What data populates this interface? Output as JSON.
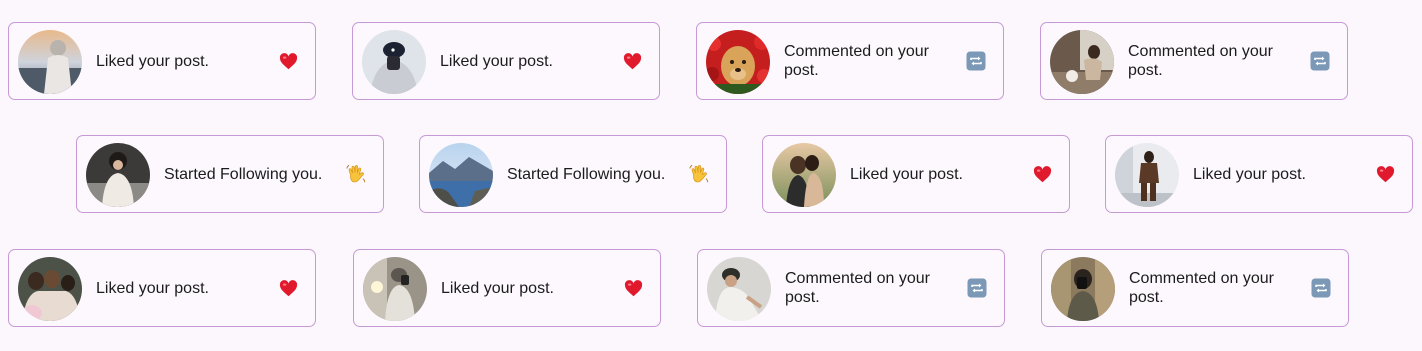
{
  "colors": {
    "background": "#fbf7fd",
    "card_border": "#c79ad6",
    "heart": "#e0192d",
    "repost": "#7b98b6"
  },
  "notifications": [
    {
      "message": "Liked your post.",
      "reaction_icon": "heart-icon",
      "avatar": "sunset-beach-photo"
    },
    {
      "message": "Liked your post.",
      "reaction_icon": "heart-icon",
      "avatar": "cap-selfie-photo"
    },
    {
      "message": "Commented on your post.",
      "reaction_icon": "repost-icon",
      "avatar": "golden-retriever-photo"
    },
    {
      "message": "Commented on your post.",
      "reaction_icon": "repost-icon",
      "avatar": "cafe-photo"
    },
    {
      "message": "Started Following you.",
      "reaction_icon": "waving-hand-icon",
      "avatar": "winter-coat-photo"
    },
    {
      "message": "Started Following you.",
      "reaction_icon": "waving-hand-icon",
      "avatar": "coastline-photo"
    },
    {
      "message": "Liked your post.",
      "reaction_icon": "heart-icon",
      "avatar": "friends-hug-photo"
    },
    {
      "message": "Liked your post.",
      "reaction_icon": "heart-icon",
      "avatar": "street-outfit-photo"
    },
    {
      "message": "Liked your post.",
      "reaction_icon": "heart-icon",
      "avatar": "group-selfie-photo"
    },
    {
      "message": "Liked your post.",
      "reaction_icon": "heart-icon",
      "avatar": "mirror-selfie-photo"
    },
    {
      "message": "Commented on your post.",
      "reaction_icon": "repost-icon",
      "avatar": "white-cap-photo"
    },
    {
      "message": "Commented on your post.",
      "reaction_icon": "repost-icon",
      "avatar": "mirror-phone-photo"
    }
  ]
}
